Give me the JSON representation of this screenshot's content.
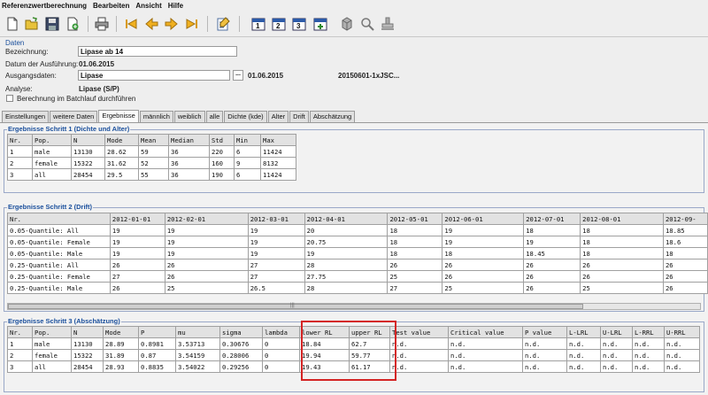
{
  "menu": [
    "Referenzwertberechnung",
    "Bearbeiten",
    "Ansicht",
    "Hilfe"
  ],
  "toolbar": {
    "icons": [
      "new-document-icon",
      "open-folder-icon",
      "save-disk-icon",
      "add-document-icon",
      "print-icon",
      "first-record-icon",
      "previous-record-icon",
      "next-record-icon",
      "last-record-icon",
      "edit-notepad-icon",
      "step-1-calendar-icon",
      "step-2-calendar-icon",
      "step-3-calendar-icon",
      "calendar-add-icon",
      "cube-icon",
      "search-magnifier-icon",
      "stamp-icon"
    ],
    "step1_label": "1",
    "step2_label": "2",
    "step3_label": "3"
  },
  "daten": {
    "legend": "Daten",
    "bezeichnung_label": "Bezeichnung:",
    "bezeichnung_value": "Lipase ab 14",
    "datum_label": "Datum der Ausführung:",
    "datum_value": "01.06.2015",
    "ausgang_label": "Ausgangsdaten:",
    "ausgang_value": "Lipase",
    "ausgang_browse": "...",
    "ausgang_date": "01.06.2015",
    "ausgang_file": "20150601-1xJSC...",
    "analyse_label": "Analyse:",
    "analyse_value": "Lipase (S/P)",
    "batch_label": "Berechnung im Batchlauf durchführen"
  },
  "tabs": [
    "Einstellungen",
    "weitere Daten",
    "Ergebnisse",
    "männlich",
    "weiblich",
    "alle",
    "Dichte (kde)",
    "Alter",
    "Drift",
    "Abschätzung"
  ],
  "step1": {
    "caption": "Ergebnisse Schritt 1 (Dichte und Alter)",
    "headers": [
      "Nr.",
      "Pop.",
      "N",
      "Mode",
      "Mean",
      "Median",
      "Std",
      "Min",
      "Max"
    ],
    "rows": [
      [
        "1",
        "male",
        "13130",
        "28.62",
        "59",
        "36",
        "220",
        "6",
        "11424"
      ],
      [
        "2",
        "female",
        "15322",
        "31.62",
        "52",
        "36",
        "160",
        "9",
        "8132"
      ],
      [
        "3",
        "all",
        "28454",
        "29.5",
        "55",
        "36",
        "190",
        "6",
        "11424"
      ]
    ]
  },
  "step2": {
    "caption": "Ergebnisse Schritt 2 (Drift)",
    "headers": [
      "Nr.",
      "2012-01-01",
      "2012-02-01",
      "2012-03-01",
      "2012-04-01",
      "2012-05-01",
      "2012-06-01",
      "2012-07-01",
      "2012-08-01",
      "2012-09-"
    ],
    "rows": [
      [
        "0.05-Quantile: All",
        "19",
        "19",
        "19",
        "20",
        "18",
        "19",
        "18",
        "18",
        "18.85"
      ],
      [
        "0.05-Quantile: Female",
        "19",
        "19",
        "19",
        "20.75",
        "18",
        "19",
        "19",
        "18",
        "18.6"
      ],
      [
        "0.05-Quantile: Male",
        "19",
        "19",
        "19",
        "19",
        "18",
        "18",
        "18.45",
        "18",
        "18"
      ],
      [
        "0.25-Quantile: All",
        "26",
        "26",
        "27",
        "28",
        "26",
        "26",
        "26",
        "26",
        "26"
      ],
      [
        "0.25-Quantile: Female",
        "27",
        "26",
        "27",
        "27.75",
        "25",
        "26",
        "26",
        "26",
        "26"
      ],
      [
        "0.25-Quantile: Male",
        "26",
        "25",
        "26.5",
        "28",
        "27",
        "25",
        "26",
        "25",
        "26"
      ]
    ],
    "scroll_grip": "|||"
  },
  "step3": {
    "caption": "Ergebnisse Schritt 3 (Abschätzung)",
    "headers": [
      "Nr.",
      "Pop.",
      "N",
      "Mode",
      "P",
      "mu",
      "sigma",
      "lambda",
      "lower RL",
      "upper RL",
      "Test value",
      "Critical value",
      "P value",
      "L-LRL",
      "U-LRL",
      "L-RRL",
      "U-RRL"
    ],
    "rows": [
      [
        "1",
        "male",
        "13130",
        "28.89",
        "0.8981",
        "3.53713",
        "0.30676",
        "0",
        "18.84",
        "62.7",
        "n.d.",
        "n.d.",
        "n.d.",
        "n.d.",
        "n.d.",
        "n.d.",
        "n.d."
      ],
      [
        "2",
        "female",
        "15322",
        "31.89",
        "0.87",
        "3.54159",
        "0.28006",
        "0",
        "19.94",
        "59.77",
        "n.d.",
        "n.d.",
        "n.d.",
        "n.d.",
        "n.d.",
        "n.d.",
        "n.d."
      ],
      [
        "3",
        "all",
        "28454",
        "28.93",
        "0.8835",
        "3.54022",
        "0.29256",
        "0",
        "19.43",
        "61.17",
        "n.d.",
        "n.d.",
        "n.d.",
        "n.d.",
        "n.d.",
        "n.d.",
        "n.d."
      ]
    ]
  },
  "colors": {
    "highlight": "#d42424",
    "caption": "#1a4f9c"
  }
}
